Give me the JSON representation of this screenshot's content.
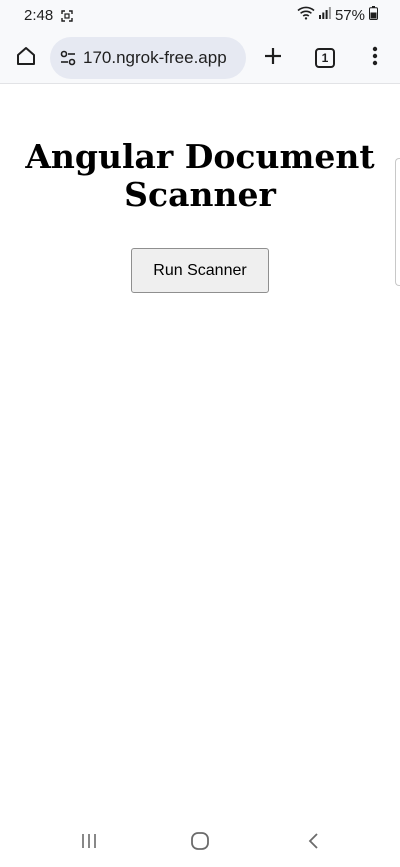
{
  "status_bar": {
    "time": "2:48",
    "battery": "57%"
  },
  "browser": {
    "url": "170.ngrok-free.app",
    "tab_count": "1"
  },
  "page": {
    "title": "Angular Document Scanner",
    "run_button_label": "Run Scanner"
  },
  "icons": {
    "status": [
      "screenshot-icon",
      "wifi-icon",
      "signal-icon",
      "battery-icon"
    ],
    "toolbar": [
      "home-icon",
      "tune-icon",
      "plus-icon",
      "tabs-icon",
      "more-vert-icon"
    ],
    "nav": [
      "recents-icon",
      "home-circle-icon",
      "back-icon"
    ]
  }
}
